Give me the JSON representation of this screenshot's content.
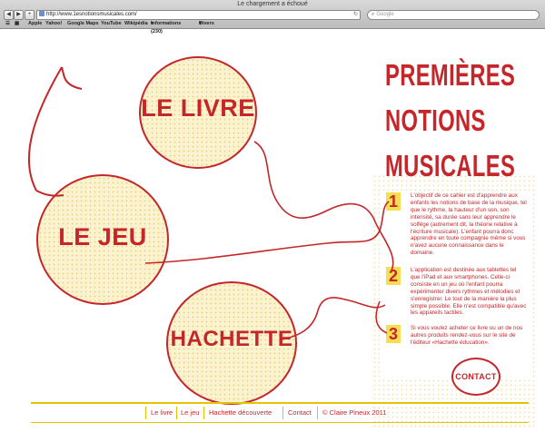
{
  "browser": {
    "window_title": "Le chargement a échoué",
    "url": "http://www.1esnotionsmusicales.com/",
    "search_placeholder": "Google",
    "bookmarks": [
      "Apple",
      "Yahoo!",
      "Google Maps",
      "YouTube",
      "Wikipédia",
      "Informations (230)",
      "Divers"
    ]
  },
  "site": {
    "title_lines": [
      "Premières",
      "notions",
      "musicales"
    ],
    "circles": [
      "Le livre",
      "Le jeu",
      "Hachette"
    ],
    "points": [
      {
        "number": "1",
        "text": "L'objectif de ce cahier est d'apprendre aux enfants les notions de base de la musique, tel que le rythme, la hauteur d'un son, son intensité, sa durée sans leur apprendre le solfège (autrement dit, la théorie relative à l'écriture musicale). L'enfant pourra donc apprendre en toute compagnie même si vous n'avez aucune connaissance dans le domaine."
      },
      {
        "number": "2",
        "text": "L'application est destinée aux tablettes tel que l'iPad et aux smartphones. Celle-ci consiste en un jeu où l'enfant pourra expérimenter divers rythmes et mélodies et s'enregistrer. Le tout de la manière la plus simple possible. Elle n'est compatible qu'avec les appareils tactiles."
      },
      {
        "number": "3",
        "text": "Si vous voulez acheter ce livre ou un de nos autres produits rendez-vous sur le site de l'éditeur «Hachette éducation»."
      }
    ],
    "contact_label": "Contact",
    "footer": [
      "Le livre",
      "Le jeu",
      "Hachette découverte",
      "Contact",
      "© Claire Pineux 2011"
    ]
  },
  "colors": {
    "accent": "#c4262a",
    "yellow": "#e2c400",
    "circle_fill": "#fbf2cf"
  }
}
